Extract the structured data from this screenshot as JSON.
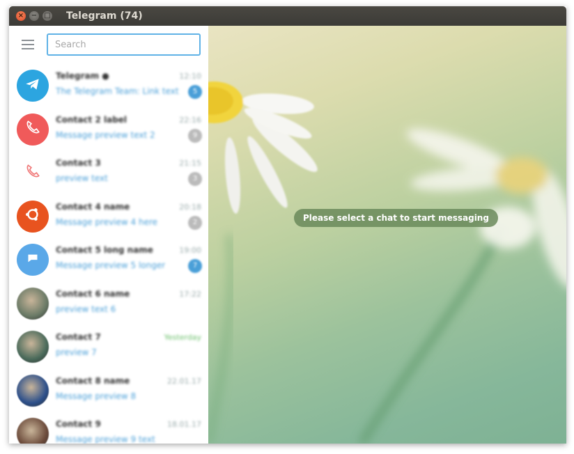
{
  "window": {
    "title": "Telegram (74)"
  },
  "search": {
    "placeholder": "Search"
  },
  "chats": [
    {
      "name": "Telegram ●",
      "time": "12:10",
      "preview": "The Telegram Team: Link text",
      "badge": "5",
      "color": "#2ca5e0",
      "icon": "telegram-plane-icon",
      "unread_color": "#4a9fd8"
    },
    {
      "name": "Contact 2 label",
      "time": "22:16",
      "preview": "Message preview text 2",
      "badge": "9",
      "color": "#f05a5a",
      "icon": "phone-icon",
      "unread_color": "#bbb"
    },
    {
      "name": "Contact 3",
      "time": "21:15",
      "preview": "preview text",
      "badge": "3",
      "color": "#ffffff",
      "icon": "phone-outline-icon",
      "unread_color": "#bbb"
    },
    {
      "name": "Contact 4 name",
      "time": "20:18",
      "preview": "Message preview 4 here",
      "badge": "2",
      "color": "#e8531f",
      "icon": "ubuntu-logo-icon",
      "unread_color": "#bbb"
    },
    {
      "name": "Contact 5 long name",
      "time": "19:00",
      "preview": "Message preview 5 longer",
      "badge": "7",
      "color": "#5aa8e8",
      "icon": "group-icon",
      "unread_color": "#4a9fd8"
    },
    {
      "name": "Contact 6 name",
      "time": "17:22",
      "preview": "preview text 6",
      "badge": "",
      "color": "#6a7a66",
      "icon": "photo-avatar-icon",
      "unread_color": ""
    },
    {
      "name": "Contact 7",
      "time": "Yesterday",
      "preview": "preview 7",
      "badge": "",
      "color": "#4a6a5a",
      "icon": "photo-avatar-icon",
      "unread_color": ""
    },
    {
      "name": "Contact 8 name",
      "time": "22.01.17",
      "preview": "Message preview 8",
      "badge": "",
      "color": "#2c4f8a",
      "icon": "photo-avatar-icon",
      "unread_color": ""
    },
    {
      "name": "Contact 9",
      "time": "18.01.17",
      "preview": "Message preview 9 text",
      "badge": "",
      "color": "#6b4a3a",
      "icon": "photo-avatar-icon",
      "unread_color": ""
    }
  ],
  "main": {
    "empty_message": "Please select a chat to start messaging"
  }
}
